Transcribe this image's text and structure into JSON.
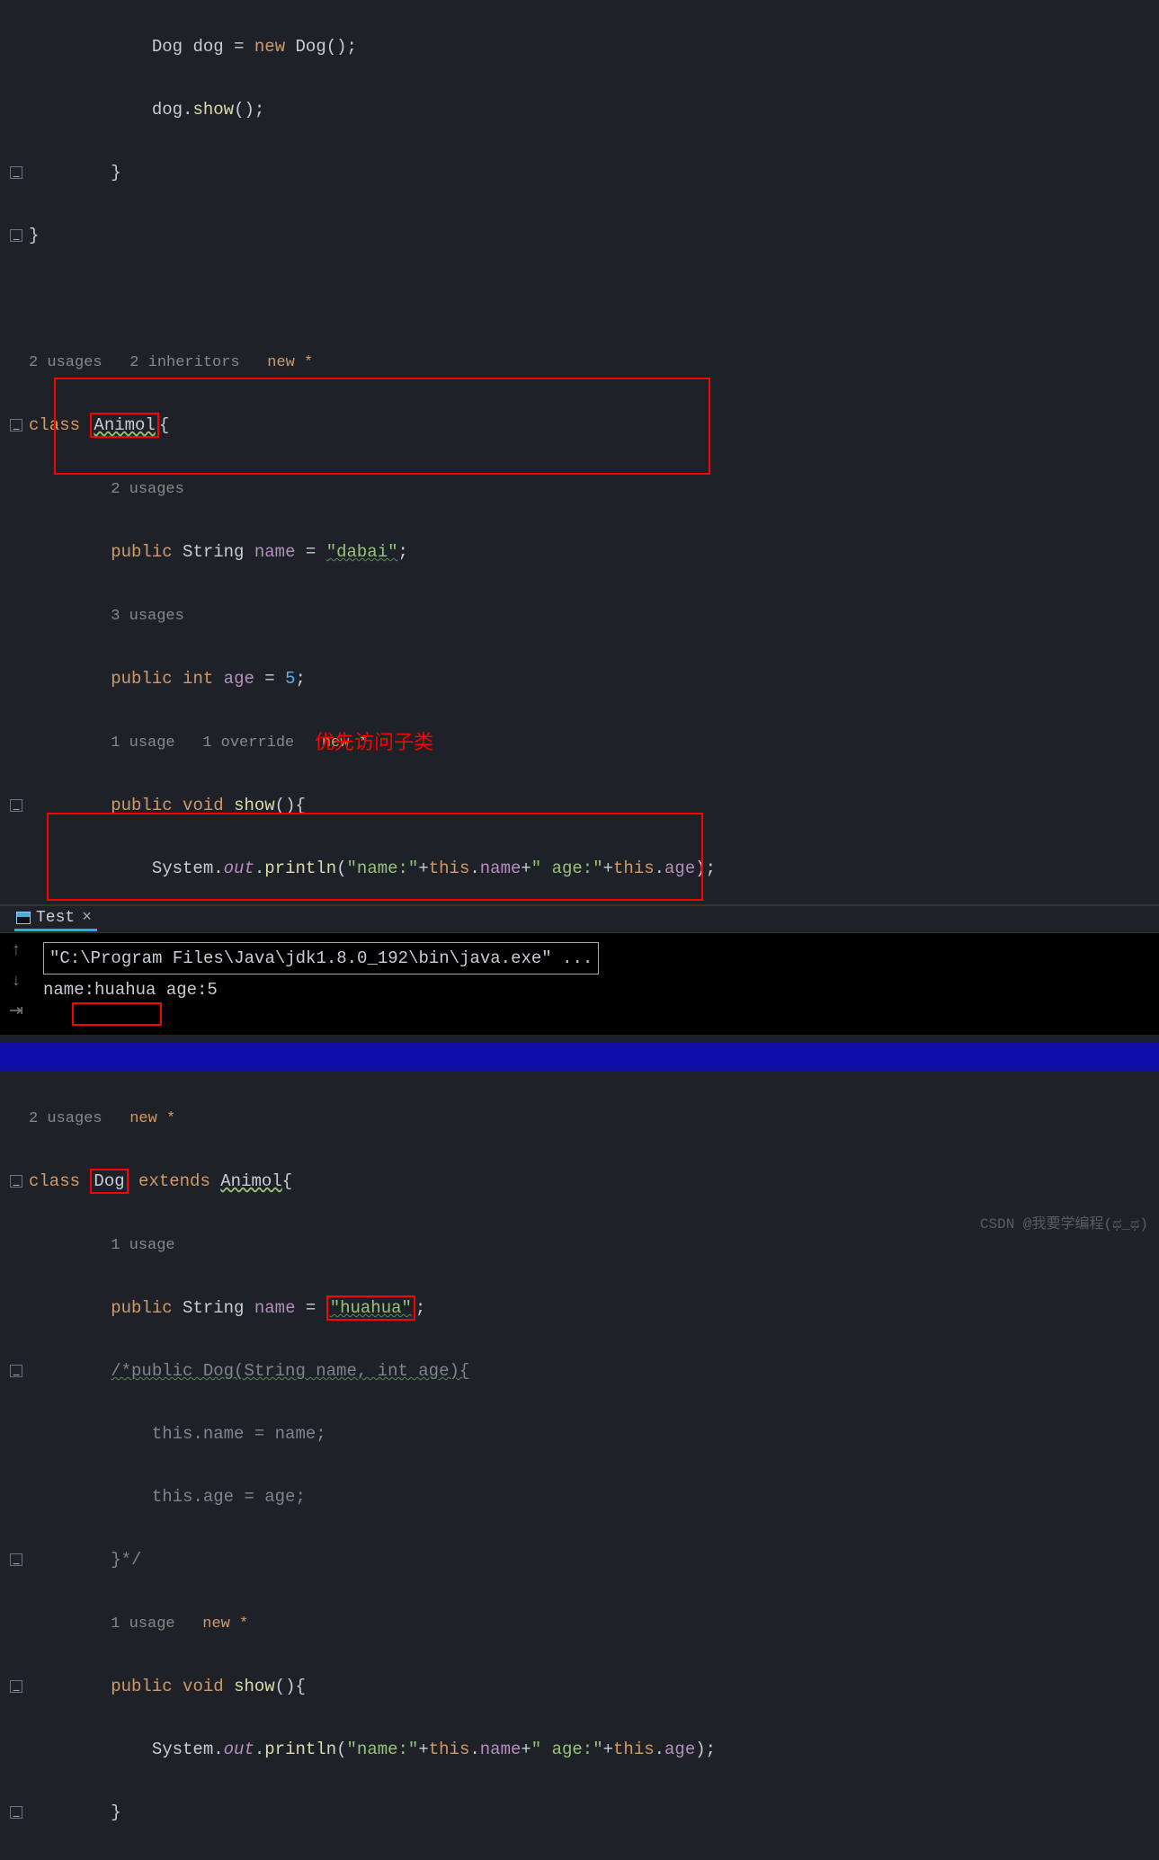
{
  "code": {
    "line1": "Dog dog = new Dog();",
    "l1_type": "Dog",
    "l1_var": "dog",
    "l1_new": "new",
    "l1_ctor": "Dog",
    "line2": "dog.show();",
    "l2_var": "dog",
    "l2_method": "show",
    "hint_animol": "2 usages   2 inheritors   ",
    "hint_new1": "new *",
    "kw_class": "class",
    "cls_animol": "Animol",
    "hint_2usages": "2 usages",
    "kw_public": "public",
    "type_string": "String",
    "field_name": "name",
    "str_dabai": "\"dabai\"",
    "hint_3usages": "3 usages",
    "type_int": "int",
    "field_age": "age",
    "num_5": "5",
    "hint_override": "1 usage   1 override   ",
    "hint_new2": "new *",
    "type_void": "void",
    "method_show": "show",
    "sys": "System",
    "out": "out",
    "println": "println",
    "str_namecolon": "\"name:\"",
    "kw_this": "this",
    "str_agecolon": "\" age:\"",
    "hint_dog": "2 usages   ",
    "hint_new3": "new *",
    "cls_dog": "Dog",
    "kw_extends": "extends",
    "hint_1usage": "1 usage",
    "str_huahua": "\"huahua\"",
    "comment_block": "/*public Dog(String name, int age){",
    "comment_l2": "this.name = name;",
    "comment_l3": "this.age = age;",
    "comment_end": "}*/",
    "hint_1usage_new": "1 usage   ",
    "hint_new4": "new *"
  },
  "annotation": {
    "text": "优先访问子类"
  },
  "console": {
    "tab": "Test",
    "cmd": "\"C:\\Program Files\\Java\\jdk1.8.0_192\\bin\\java.exe\" ...",
    "output": "name:huahua age:5"
  },
  "watermark": "CSDN @我要学编程(ಥ_ಥ)"
}
